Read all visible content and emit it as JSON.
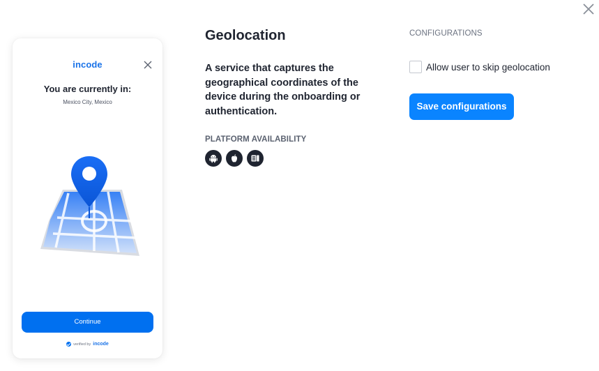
{
  "modal": {
    "close_icon": "close-icon"
  },
  "preview": {
    "logo": "incode",
    "heading": "You are currently in:",
    "location": "Mexico City, Mexico",
    "continue_label": "Continue",
    "verified_prefix": "verified by",
    "verified_brand": "incode",
    "illustration": "map-pin-illustration"
  },
  "feature": {
    "title": "Geolocation",
    "description": "A service that captures the geographical coordinates of the device during the onboarding or authentication.",
    "platform_label": "PLATFORM AVAILABILITY",
    "platforms": [
      {
        "icon": "android-icon"
      },
      {
        "icon": "apple-icon"
      },
      {
        "icon": "web-icon"
      }
    ]
  },
  "config": {
    "label": "CONFIGURATIONS",
    "skip_label": "Allow user to skip geolocation",
    "skip_checked": false,
    "save_label": "Save configurations"
  },
  "colors": {
    "accent": "#0a84ff",
    "preview_button": "#0070f0",
    "dark": "#1f2430"
  }
}
